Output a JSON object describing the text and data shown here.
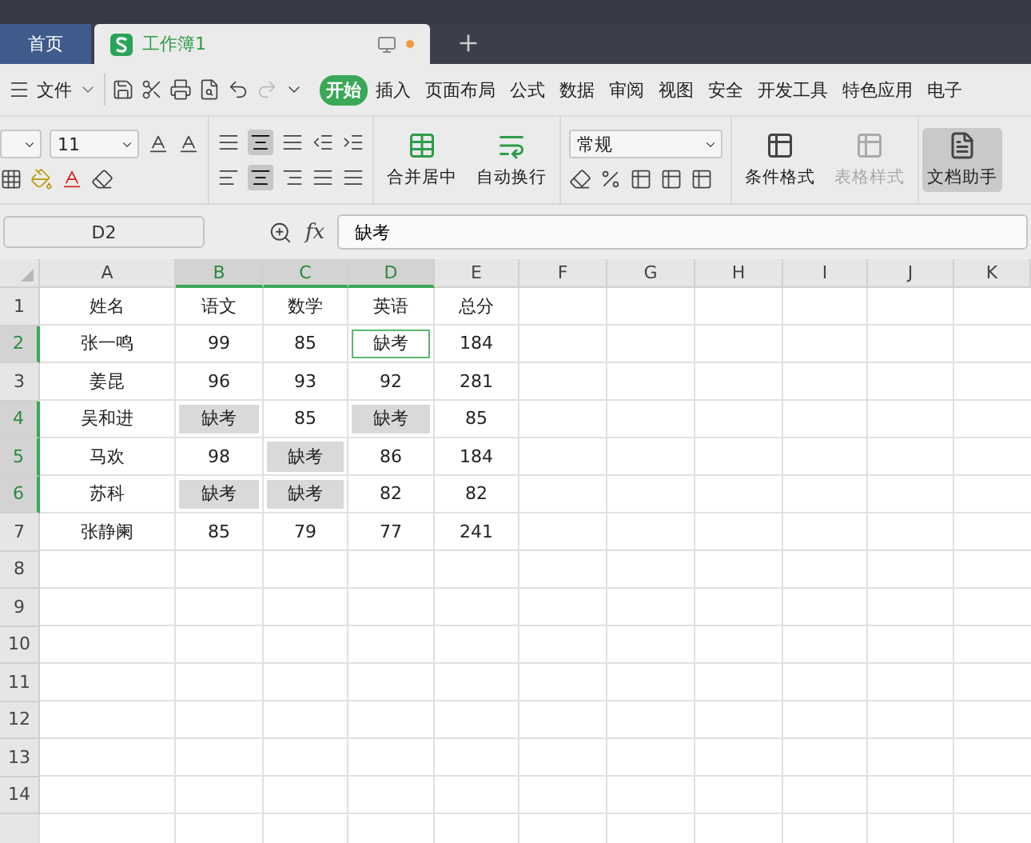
{
  "tabs": [
    {
      "label": "首页",
      "kind": "home",
      "selected": false
    },
    {
      "label": "工作簿1",
      "kind": "doc",
      "selected": true,
      "unsaved": true
    }
  ],
  "menu": {
    "file": "文件",
    "items": [
      {
        "label": "开始",
        "selected": true
      },
      {
        "label": "插入",
        "selected": false
      },
      {
        "label": "页面布局",
        "selected": false
      },
      {
        "label": "公式",
        "selected": false
      },
      {
        "label": "数据",
        "selected": false
      },
      {
        "label": "审阅",
        "selected": false
      },
      {
        "label": "视图",
        "selected": false
      },
      {
        "label": "安全",
        "selected": false
      },
      {
        "label": "开发工具",
        "selected": false
      },
      {
        "label": "特色应用",
        "selected": false
      },
      {
        "label": "电子",
        "selected": false
      }
    ]
  },
  "toolbar": {
    "font_size": "11",
    "align_center_on": true,
    "merge": "合并居中",
    "wrap": "自动换行",
    "number_format": "常规",
    "conditional": "条件格式",
    "table_style": {
      "label": "表格样式",
      "disabled": true
    },
    "assistant": {
      "label": "文档助手",
      "selected": true
    }
  },
  "formula_bar": {
    "cell_ref": "D2",
    "fx": "fx",
    "value": "缺考"
  },
  "columns": [
    {
      "label": "A",
      "selected": false
    },
    {
      "label": "B",
      "selected": true
    },
    {
      "label": "C",
      "selected": true
    },
    {
      "label": "D",
      "selected": true
    },
    {
      "label": "E",
      "selected": false
    },
    {
      "label": "F",
      "selected": false
    },
    {
      "label": "G",
      "selected": false
    },
    {
      "label": "H",
      "selected": false
    },
    {
      "label": "I",
      "selected": false
    },
    {
      "label": "J",
      "selected": false
    },
    {
      "label": "K",
      "selected": false
    }
  ],
  "rows": [
    {
      "header": "1",
      "selected": false,
      "cells": [
        {
          "text": "姓名",
          "shaded": false,
          "active": false
        },
        {
          "text": "语文",
          "shaded": false,
          "active": false
        },
        {
          "text": "数学",
          "shaded": false,
          "active": false
        },
        {
          "text": "英语",
          "shaded": false,
          "active": false
        },
        {
          "text": "总分",
          "shaded": false,
          "active": false
        }
      ]
    },
    {
      "header": "2",
      "selected": true,
      "cells": [
        {
          "text": "张一鸣",
          "shaded": false,
          "active": false
        },
        {
          "text": "99",
          "shaded": false,
          "active": false
        },
        {
          "text": "85",
          "shaded": false,
          "active": false
        },
        {
          "text": "缺考",
          "shaded": false,
          "active": true
        },
        {
          "text": "184",
          "shaded": false,
          "active": false
        }
      ]
    },
    {
      "header": "3",
      "selected": false,
      "cells": [
        {
          "text": "姜昆",
          "shaded": false,
          "active": false
        },
        {
          "text": "96",
          "shaded": false,
          "active": false
        },
        {
          "text": "93",
          "shaded": false,
          "active": false
        },
        {
          "text": "92",
          "shaded": false,
          "active": false
        },
        {
          "text": "281",
          "shaded": false,
          "active": false
        }
      ]
    },
    {
      "header": "4",
      "selected": true,
      "cells": [
        {
          "text": "吴和进",
          "shaded": false,
          "active": false
        },
        {
          "text": "缺考",
          "shaded": true,
          "active": false
        },
        {
          "text": "85",
          "shaded": false,
          "active": false
        },
        {
          "text": "缺考",
          "shaded": true,
          "active": false
        },
        {
          "text": "85",
          "shaded": false,
          "active": false
        }
      ]
    },
    {
      "header": "5",
      "selected": true,
      "cells": [
        {
          "text": "马欢",
          "shaded": false,
          "active": false
        },
        {
          "text": "98",
          "shaded": false,
          "active": false
        },
        {
          "text": "缺考",
          "shaded": true,
          "active": false
        },
        {
          "text": "86",
          "shaded": false,
          "active": false
        },
        {
          "text": "184",
          "shaded": false,
          "active": false
        }
      ]
    },
    {
      "header": "6",
      "selected": true,
      "cells": [
        {
          "text": "苏科",
          "shaded": false,
          "active": false
        },
        {
          "text": "缺考",
          "shaded": true,
          "active": false
        },
        {
          "text": "缺考",
          "shaded": true,
          "active": false
        },
        {
          "text": "82",
          "shaded": false,
          "active": false
        },
        {
          "text": "82",
          "shaded": false,
          "active": false
        }
      ]
    },
    {
      "header": "7",
      "selected": false,
      "cells": [
        {
          "text": "张静阑",
          "shaded": false,
          "active": false
        },
        {
          "text": "85",
          "shaded": false,
          "active": false
        },
        {
          "text": "79",
          "shaded": false,
          "active": false
        },
        {
          "text": "77",
          "shaded": false,
          "active": false
        },
        {
          "text": "241",
          "shaded": false,
          "active": false
        }
      ]
    },
    {
      "header": "8",
      "selected": false
    },
    {
      "header": "9",
      "selected": false
    },
    {
      "header": "10",
      "selected": false
    },
    {
      "header": "11",
      "selected": false
    },
    {
      "header": "12",
      "selected": false
    },
    {
      "header": "13",
      "selected": false
    },
    {
      "header": "14",
      "selected": false
    }
  ]
}
